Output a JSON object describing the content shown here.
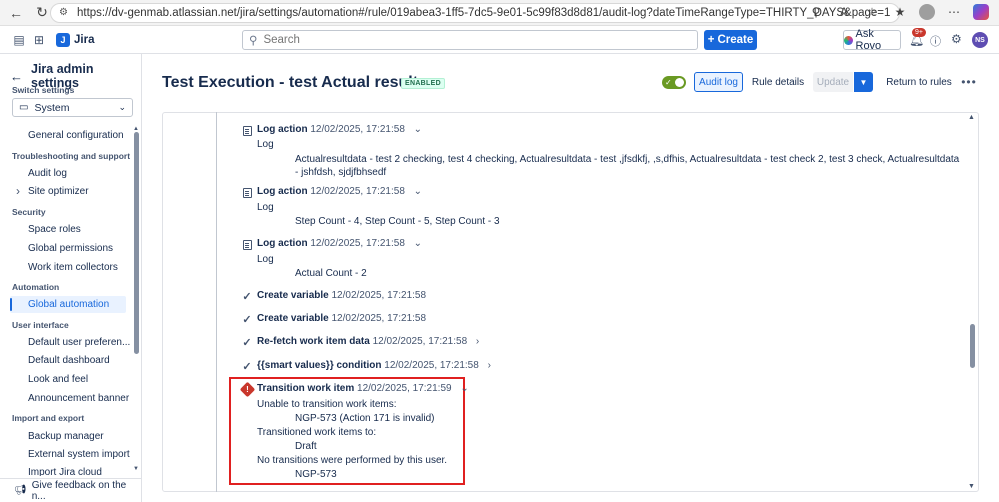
{
  "browser": {
    "url": "https://dv-genmab.atlassian.net/jira/settings/automation#/rule/019abea3-1ff5-7dc5-9e01-5c99f83d8d81/audit-log?dateTimeRangeType=THIRTY_DAYS&page=1"
  },
  "topnav": {
    "app_name": "Jira",
    "search_placeholder": "Search",
    "create_label": "Create",
    "ask_rovo_label": "Ask Rovo",
    "notification_count": "9+",
    "user_initials": "NS"
  },
  "sidebar": {
    "title": "Jira admin settings",
    "switch_label": "Switch settings",
    "switch_value": "System",
    "groups": [
      {
        "heading": "",
        "items": [
          "General configuration"
        ]
      },
      {
        "heading": "Troubleshooting and support",
        "items": [
          "Audit log",
          "Site optimizer"
        ]
      },
      {
        "heading": "Security",
        "items": [
          "Space roles",
          "Global permissions",
          "Work item collectors"
        ]
      },
      {
        "heading": "Automation",
        "items": [
          "Global automation"
        ]
      },
      {
        "heading": "User interface",
        "items": [
          "Default user preferen...",
          "Default dashboard",
          "Look and feel",
          "Announcement banner"
        ]
      },
      {
        "heading": "Import and export",
        "items": [
          "Backup manager",
          "External system import",
          "Import Jira cloud"
        ]
      }
    ],
    "feedback_label": "Give feedback on the n..."
  },
  "header": {
    "title": "Test Execution - test Actual results",
    "status_badge": "ENABLED",
    "audit_log_label": "Audit log",
    "rule_details_label": "Rule details",
    "update_label": "Update",
    "return_label": "Return to rules"
  },
  "log": {
    "entries": [
      {
        "action": "Log action",
        "time": "12/02/2025, 17:21:58",
        "sub_label": "Log",
        "detail": "Actualresultdata - test 2 checking, test 4 checking, Actualresultdata - test ,jfsdkfj, ,s,dfhis, Actualresultdata - test check 2, test 3 check, Actualresultdata - jshfdsh, sjdjfbhsedf"
      },
      {
        "action": "Log action",
        "time": "12/02/2025, 17:21:58",
        "sub_label": "Log",
        "detail": "Step Count - 4, Step Count - 5, Step Count - 3"
      },
      {
        "action": "Log action",
        "time": "12/02/2025, 17:21:58",
        "sub_label": "Log",
        "detail": "Actual Count - 2"
      },
      {
        "action": "Create variable",
        "time": "12/02/2025, 17:21:58"
      },
      {
        "action": "Create variable",
        "time": "12/02/2025, 17:21:58"
      },
      {
        "action": "Re-fetch work item data",
        "time": "12/02/2025, 17:21:58"
      },
      {
        "action": "{{smart values}} condition",
        "time": "12/02/2025, 17:21:58"
      },
      {
        "action": "Transition work item",
        "time": "12/02/2025, 17:21:59",
        "unable_label": "Unable to transition work items:",
        "unable_detail": "NGP-573 (Action 171 is invalid)",
        "transitioned_label": "Transitioned work items to:",
        "transitioned_detail": "Draft",
        "none_label": "No transitions were performed by this user.",
        "none_detail": "NGP-573"
      }
    ]
  }
}
